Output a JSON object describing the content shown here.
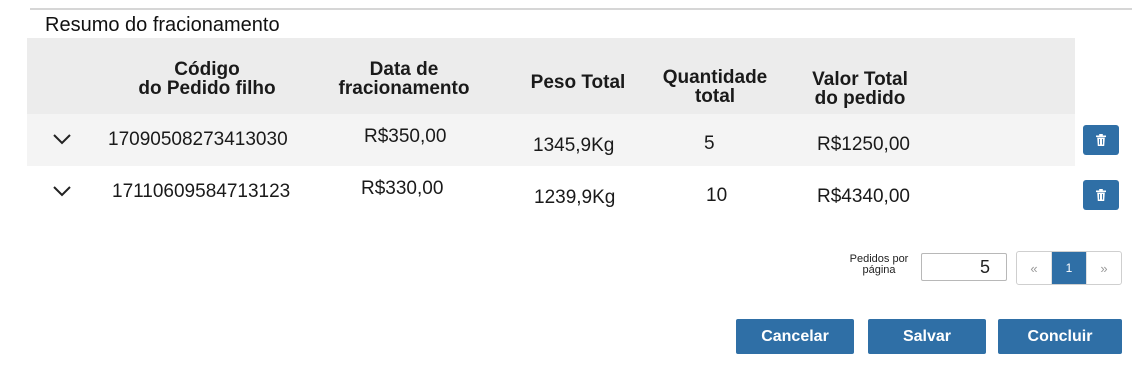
{
  "section": {
    "title": "Resumo do fracionamento"
  },
  "table": {
    "headers": {
      "codigo": "Código\ndo Pedido filho",
      "data": "Data de\nfracionamento",
      "peso": "Peso Total",
      "quantidade": "Quantidade\ntotal",
      "valor": "Valor Total\ndo pedido"
    },
    "rows": [
      {
        "codigo": "17090508273413030",
        "data": "R$350,00",
        "peso": "1345,9Kg",
        "quantidade": "5",
        "valor": "R$1250,00"
      },
      {
        "codigo": "17110609584713123",
        "data": "R$330,00",
        "peso": "1239,9Kg",
        "quantidade": "10",
        "valor": "R$4340,00"
      }
    ],
    "expand_icon": "chevron-down-icon",
    "delete_icon": "trash-icon"
  },
  "pagination": {
    "per_page_label": "Pedidos por\npágina",
    "per_page_value": "5",
    "prev_label": "«",
    "current_page": "1",
    "next_label": "»"
  },
  "actions": {
    "cancel_label": "Cancelar",
    "save_label": "Salvar",
    "finish_label": "Concluir"
  },
  "colors": {
    "primary": "#2f6fa6",
    "header_bg": "#ececec",
    "row_alt_bg": "#f4f4f4"
  }
}
